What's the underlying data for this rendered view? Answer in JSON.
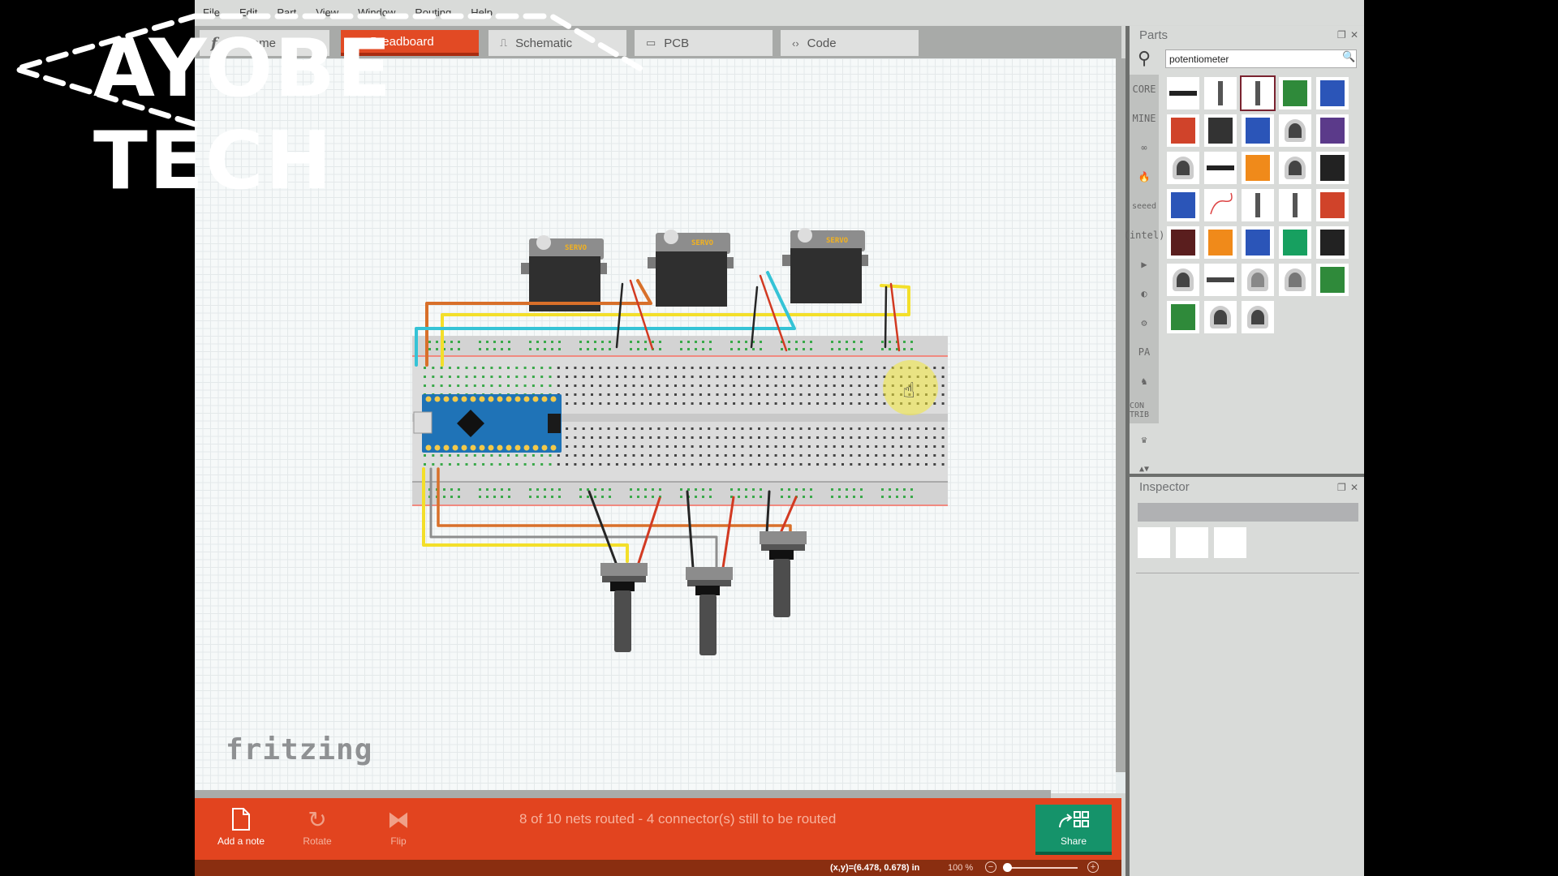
{
  "app": {
    "name": "Fritzing",
    "menu": [
      "File",
      "Edit",
      "Part",
      "View",
      "Window",
      "Routing",
      "Help"
    ],
    "tabs": [
      {
        "label": "Welcome",
        "icon": "fritzing-f-icon",
        "active": false
      },
      {
        "label": "Breadboard",
        "icon": "breadboard-grid-icon",
        "active": true
      },
      {
        "label": "Schematic",
        "icon": "schematic-icon",
        "active": false
      },
      {
        "label": "PCB",
        "icon": "pcb-icon",
        "active": false
      },
      {
        "label": "Code",
        "icon": "code-brackets-icon",
        "active": false
      }
    ]
  },
  "canvas": {
    "logo_text": "fritzing",
    "components": {
      "servos": [
        {
          "label": "SERVO"
        },
        {
          "label": "SERVO"
        },
        {
          "label": "SERVO"
        }
      ],
      "potentiometers": 3,
      "microcontroller": "Arduino Nano",
      "breadboard": "full+"
    },
    "wire_colors": {
      "orange": "#d8702a",
      "yellow": "#f3df2a",
      "cyan": "#35c3d6",
      "red": "#d23a22",
      "black": "#262626",
      "gray": "#8e8e8e"
    }
  },
  "toolbar": {
    "add_note_label": "Add a note",
    "rotate_label": "Rotate",
    "flip_label": "Flip",
    "share_label": "Share",
    "routing_status": "8 of 10 nets routed - 4 connector(s) still to be routed"
  },
  "statusbar": {
    "coords": "(x,y)=(6.478, 0.678) in",
    "zoom": "100 %",
    "zoom_out": "−",
    "zoom_in": "+"
  },
  "parts": {
    "title": "Parts",
    "search_value": "potentiometer",
    "bins": [
      "CORE",
      "MINE",
      "arduino",
      "sparkfun",
      "seeed",
      "intel",
      "play",
      "snootlab",
      "adafruit",
      "PA",
      "animal",
      "CON TRIB",
      "crown"
    ],
    "results": [
      "header-strip",
      "slide-pot-tall",
      "slide-pot-selected",
      "green-breakout",
      "blue-trimpot",
      "red-shield",
      "black-slide",
      "blue-trimpot",
      "rotary-pot",
      "purple-board",
      "rotary-pot",
      "header-strip",
      "orange-trimpot",
      "rotary-pot",
      "slide-switch",
      "blue-trimpot",
      "flex-sensor",
      "slide-pot-tall",
      "slide-pot-tall",
      "red-breakout",
      "lcd-board",
      "orange-trimpot",
      "blue-trimpot",
      "green-ic-board",
      "joystick",
      "rotary-pot",
      "thin-slider",
      "knob-pot",
      "gray-knob",
      "green-breakout",
      "green-long-board",
      "rotary-pot",
      "rotary-pot"
    ],
    "selected_index": 2
  },
  "inspector": {
    "title": "Inspector"
  },
  "watermark": {
    "text": "AYOBE TECH"
  }
}
